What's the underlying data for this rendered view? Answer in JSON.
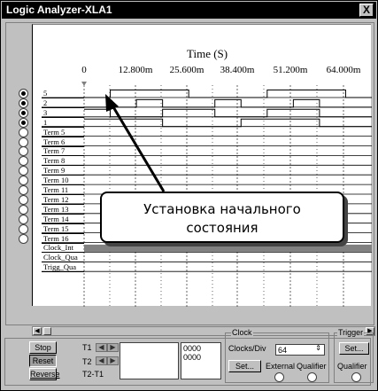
{
  "window": {
    "title": "Logic Analyzer-XLA1",
    "close_glyph": "X"
  },
  "axis": {
    "title": "Time (S)",
    "ticks": [
      "0",
      "12.800m",
      "25.600m",
      "38.400m",
      "51.200m",
      "64.000m"
    ]
  },
  "channels": [
    {
      "label": "5",
      "active": true
    },
    {
      "label": "2",
      "active": true
    },
    {
      "label": "3",
      "active": true
    },
    {
      "label": "1",
      "active": true
    },
    {
      "label": "Term 5",
      "active": false
    },
    {
      "label": "Term 6",
      "active": false
    },
    {
      "label": "Term 7",
      "active": false
    },
    {
      "label": "Term 8",
      "active": false
    },
    {
      "label": "Term 9",
      "active": false
    },
    {
      "label": "Term 10",
      "active": false
    },
    {
      "label": "Term 11",
      "active": false
    },
    {
      "label": "Term 12",
      "active": false
    },
    {
      "label": "Term 13",
      "active": false
    },
    {
      "label": "Term 14",
      "active": false
    },
    {
      "label": "Term 15",
      "active": false
    },
    {
      "label": "Term 16",
      "active": false
    },
    {
      "label": "Clock_Int",
      "active": false
    },
    {
      "label": "Clock_Qua",
      "active": false
    },
    {
      "label": "Trigg_Qua",
      "active": false
    }
  ],
  "signals": {
    "ch5": [
      0,
      1,
      1,
      1,
      0,
      0,
      0,
      1,
      1,
      1,
      0
    ],
    "ch2": [
      0,
      0,
      1,
      0,
      0,
      1,
      0,
      0,
      1,
      0,
      0
    ],
    "ch3": [
      1,
      0,
      0,
      1,
      1,
      0,
      0,
      1,
      1,
      0,
      0
    ],
    "ch1": [
      1,
      1,
      1,
      0,
      0,
      0,
      1,
      1,
      1,
      0,
      0
    ]
  },
  "annotation": {
    "line1": "Установка начального",
    "line2": "состояния"
  },
  "controls": {
    "stop": "Stop",
    "reset": "Reset",
    "reverse": "Reverse",
    "t1": "T1",
    "t2": "T2",
    "t2t1": "T2-T1",
    "t1_value": "0000",
    "t2_value": "0000",
    "clock_group": "Clock",
    "clocks_per_div_label": "Clocks/Div",
    "clocks_per_div_value": "64",
    "clock_set": "Set...",
    "external": "External",
    "qualifier": "Qualifier",
    "trigger_group": "Trigger",
    "trigger_set": "Set...",
    "trigger_qualifier": "Qualifier"
  },
  "colors": {
    "clock_bar": "#808080",
    "plot_bg": "#ffffff",
    "window_bg": "#c0c0c0"
  }
}
